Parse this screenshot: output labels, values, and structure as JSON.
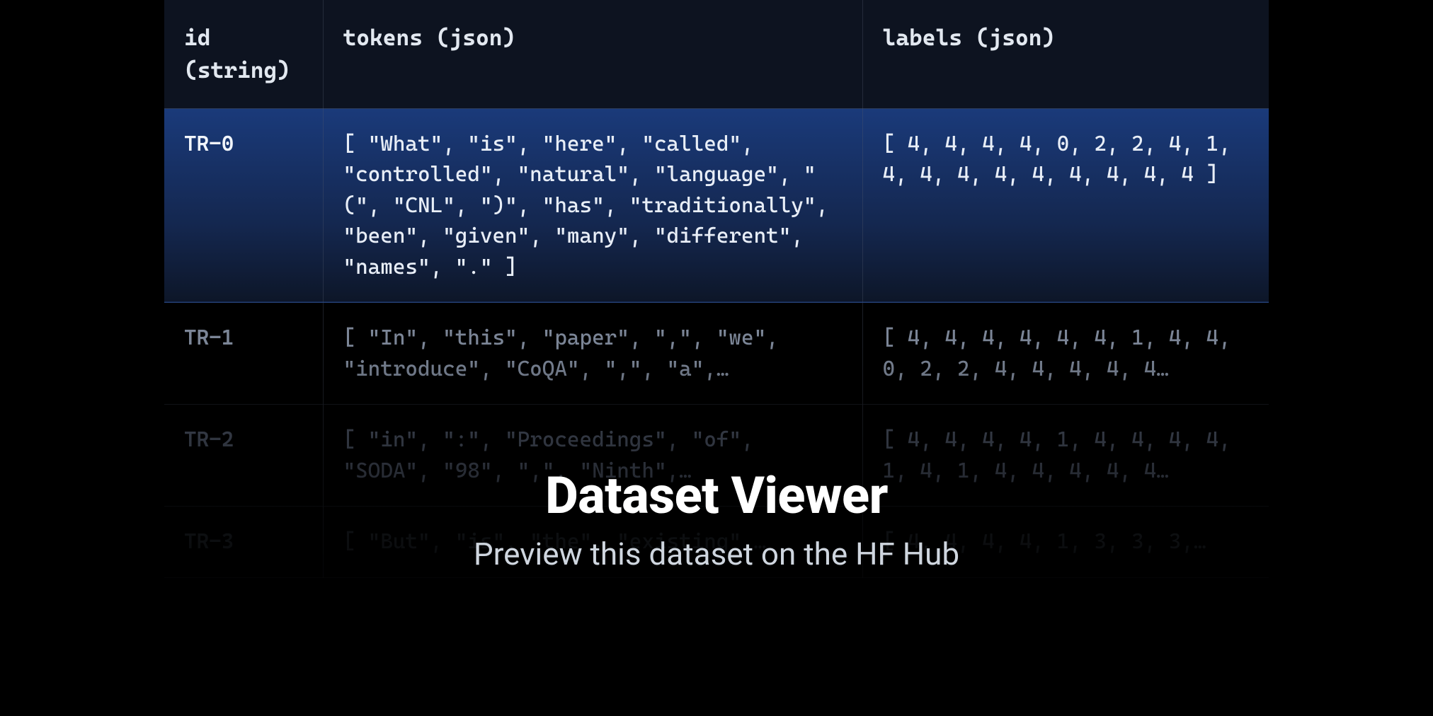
{
  "columns": {
    "id": "id\n(string)",
    "tokens": "tokens (json)",
    "labels": "labels (json)"
  },
  "rows": {
    "r0": {
      "id": "TR-0",
      "tokens": "[ \"What\", \"is\", \"here\", \"called\", \"controlled\", \"natural\", \"language\", \"(\", \"CNL\", \")\", \"has\", \"traditionally\", \"been\", \"given\", \"many\", \"different\", \"names\", \".\" ]",
      "labels": "[ 4, 4, 4, 4, 0, 2, 2, 4, 1, 4, 4, 4, 4, 4, 4, 4, 4, 4 ]"
    },
    "r1": {
      "id": "TR-1",
      "tokens": "[ \"In\", \"this\", \"paper\", \",\", \"we\", \"introduce\", \"CoQA\", \",\", \"a\",…",
      "labels": "[ 4, 4, 4, 4, 4, 4, 1, 4, 4, 0, 2, 2, 4, 4, 4, 4, 4…"
    },
    "r2": {
      "id": "TR-2",
      "tokens": "[ \"in\", \":\", \"Proceedings\", \"of\", \"SODA\", \"98\", \",\", \"Ninth\",…",
      "labels": "[ 4, 4, 4, 4, 1, 4, 4, 4, 4, 1, 4, 1, 4, 4, 4, 4, 4…"
    },
    "r3": {
      "id": "TR-3",
      "tokens": "[ \"But\", \"is\", \"the\", \"existing\",…",
      "labels": "[ 4, 4, 4, 4, 1, 3, 3, 3,…"
    }
  },
  "headline": {
    "title": "Dataset Viewer",
    "subtitle": "Preview this dataset on the HF Hub"
  }
}
